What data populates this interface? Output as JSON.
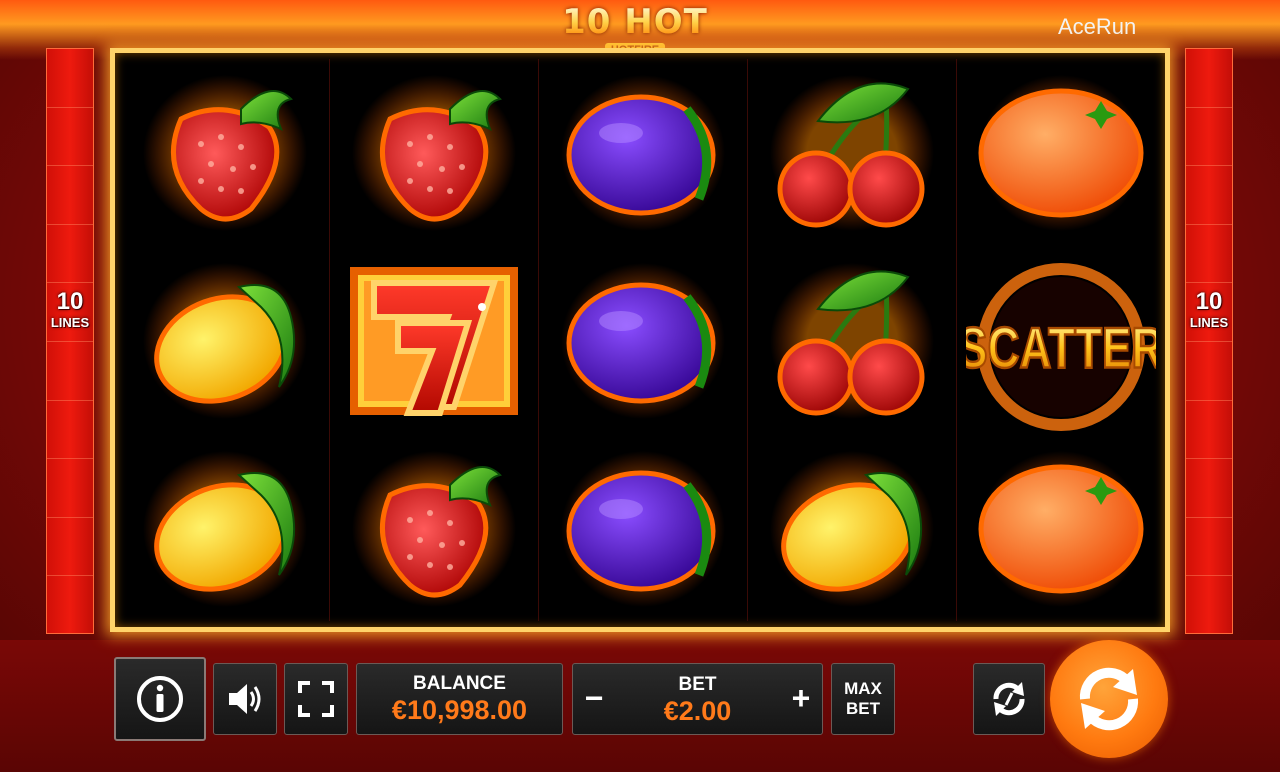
{
  "game": {
    "logo_title": "10 HOT",
    "logo_subtitle": "HOTFIRE",
    "brand": "AceRun",
    "lines_left": {
      "number": "10",
      "label": "LINES"
    },
    "lines_right": {
      "number": "10",
      "label": "LINES"
    }
  },
  "reels": [
    [
      "strawberry",
      "lemon",
      "lemon"
    ],
    [
      "strawberry",
      "seven",
      "strawberry"
    ],
    [
      "plum",
      "plum",
      "plum"
    ],
    [
      "cherries",
      "cherries",
      "lemon"
    ],
    [
      "orange",
      "scatter",
      "orange"
    ]
  ],
  "scatter_text": "SCATTER",
  "controls": {
    "info_icon": "info-icon",
    "sound_icon": "speaker-icon",
    "fullscreen_icon": "fullscreen-icon",
    "balance_label": "BALANCE",
    "balance_value": "€10,998.00",
    "bet_label": "BET",
    "bet_value": "€2.00",
    "bet_minus": "−",
    "bet_plus": "+",
    "max_label_1": "MAX",
    "max_label_2": "BET",
    "autoplay_icon": "autoplay-icon",
    "spin_icon": "spin-icon"
  },
  "colors": {
    "accent": "#ff7a1a",
    "frame": "#ffd36a",
    "panel": "#e3140c"
  }
}
